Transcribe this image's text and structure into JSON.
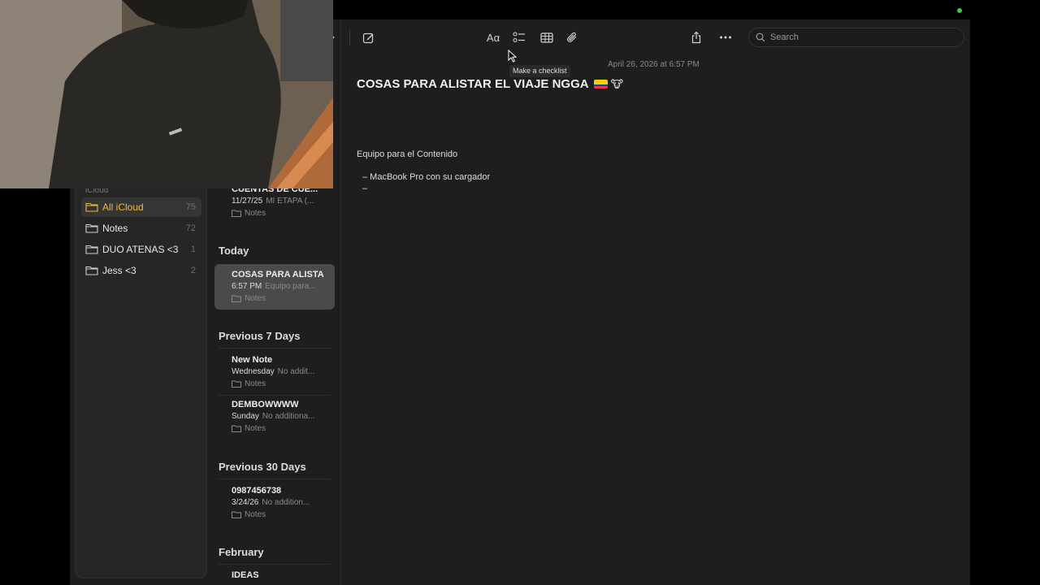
{
  "sidebar": {
    "section_label": "iCloud",
    "folders": [
      {
        "name": "All iCloud",
        "count": "75"
      },
      {
        "name": "Notes",
        "count": "72"
      },
      {
        "name": "DUO ATENAS <3",
        "count": "1"
      },
      {
        "name": "Jess <3",
        "count": "2"
      }
    ]
  },
  "notelist": {
    "top_note": {
      "title": "CUENTAS DE CUE...",
      "date": "11/27/25",
      "preview": "MI ETAPA (...",
      "folder": "Notes"
    },
    "groups": [
      {
        "title": "Today"
      },
      {
        "title": "Previous 7 Days"
      },
      {
        "title": "Previous 30 Days"
      },
      {
        "title": "February"
      }
    ],
    "notes": [
      {
        "title": "COSAS PARA ALISTA",
        "date": "6:57 PM",
        "preview": "Equipo para...",
        "folder": "Notes"
      },
      {
        "title": "New Note",
        "date": "Wednesday",
        "preview": "No addit...",
        "folder": "Notes"
      },
      {
        "title": "DEMBOWWWW",
        "date": "Sunday",
        "preview": "No additiona...",
        "folder": "Notes"
      },
      {
        "title": "0987456738",
        "date": "3/24/26",
        "preview": "No addition...",
        "folder": "Notes"
      },
      {
        "title": "IDEAS",
        "date": "",
        "preview": "",
        "folder": ""
      }
    ]
  },
  "toolbar": {
    "format_label": "Aα",
    "search_placeholder": "Search",
    "tooltip": "Make a checklist"
  },
  "editor": {
    "date": "April 26, 2026 at 6:57 PM",
    "title": "COSAS PARA ALISTAR EL VIAJE NGGA",
    "emoji": "🐮",
    "lines": [
      "Equipo para el Contenido",
      "–  MacBook Pro con su cargador",
      "–"
    ]
  },
  "colors": {
    "accent": "#f0b936",
    "flag_ecuador": [
      "#ffd100",
      "#034ea2",
      "#ef3340"
    ]
  }
}
